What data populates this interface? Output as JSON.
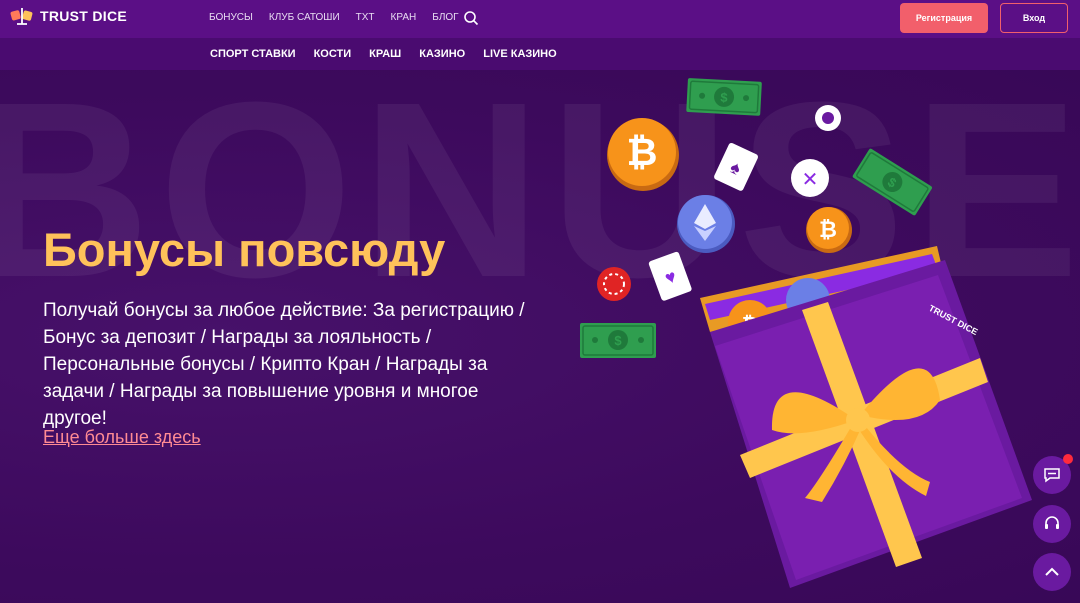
{
  "header": {
    "logo_text": "TRUST DICE",
    "nav": [
      "БОНУСЫ",
      "КЛУБ САТОШИ",
      "TXT",
      "КРАН",
      "БЛОГ"
    ],
    "register_label": "Регистрация",
    "login_label": "Вход"
  },
  "subnav": [
    "СПОРТ СТАВКИ",
    "КОСТИ",
    "КРАШ",
    "КАЗИНО",
    "LIVE КАЗИНО"
  ],
  "hero": {
    "watermark": "BONUSE",
    "title": "Бонусы повсюду",
    "description": "Получай бонусы за любое действие: За регистрацию / Бонус за депозит / Награды за лояльность / Персональные бонусы / Крипто Кран / Награды за задачи / Награды за повышение уровня и многое другое!",
    "link": "Еще больше здесь",
    "box_brand": "TRUST DICE"
  },
  "colors": {
    "header_bg": "#5b0f86",
    "subnav_bg": "#4a0b70",
    "hero_bg": "#3f0a5f",
    "title": "#ffc25a",
    "accent": "#f25f6b",
    "link": "#ff8b93"
  },
  "icons": {
    "search": "search-icon",
    "chat": "chat-icon",
    "support": "headset-icon",
    "up": "chevron-up-icon"
  }
}
